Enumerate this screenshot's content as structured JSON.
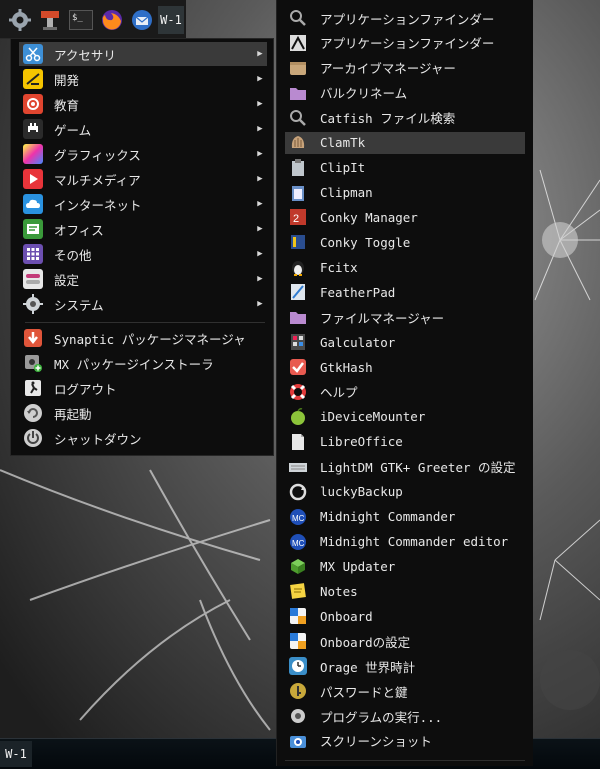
{
  "top_panel": {
    "launchers": [
      {
        "icon": "gear-icon"
      },
      {
        "icon": "package-installer-icon"
      },
      {
        "icon": "terminal-icon",
        "text": "$_"
      },
      {
        "icon": "firefox-icon"
      },
      {
        "icon": "thunderbird-icon"
      }
    ],
    "workspace_label": "W-1"
  },
  "main_menu": {
    "items": [
      {
        "label": "アクセサリ",
        "icon": "scissors-icon",
        "color": "#3d8fd6",
        "submenu": true,
        "highlighted": true
      },
      {
        "label": "開発",
        "icon": "development-icon",
        "color": "#f5c400",
        "submenu": true
      },
      {
        "label": "教育",
        "icon": "education-icon",
        "color": "#e0452f",
        "submenu": true
      },
      {
        "label": "ゲーム",
        "icon": "game-icon",
        "color": "#2b2b2b",
        "submenu": true
      },
      {
        "label": "グラフィックス",
        "icon": "graphics-icon",
        "color": "#b44fd8",
        "submenu": true
      },
      {
        "label": "マルチメディア",
        "icon": "multimedia-icon",
        "color": "#e8343a",
        "submenu": true
      },
      {
        "label": "インターネット",
        "icon": "cloud-icon",
        "color": "#2a92e0",
        "submenu": true
      },
      {
        "label": "オフィス",
        "icon": "office-icon",
        "color": "#3a9a3a",
        "submenu": true
      },
      {
        "label": "その他",
        "icon": "grid-icon",
        "color": "#6c4fb0",
        "submenu": true
      },
      {
        "label": "設定",
        "icon": "settings-icon",
        "color": "#c33a78",
        "submenu": true
      },
      {
        "label": "システム",
        "icon": "system-gear-icon",
        "color": "#6f7a82",
        "submenu": true
      }
    ],
    "actions": [
      {
        "label": "Synaptic パッケージマネージャ",
        "icon": "synaptic-icon",
        "color": "#e0553a"
      },
      {
        "label": "MX パッケージインストーラ",
        "icon": "mx-package-installer-icon",
        "color": "#8a8a8a"
      },
      {
        "label": "ログアウト",
        "icon": "logout-icon",
        "color": "#dddddd"
      },
      {
        "label": "再起動",
        "icon": "restart-icon",
        "color": "#dddddd"
      },
      {
        "label": "シャットダウン",
        "icon": "shutdown-icon",
        "color": "#dddddd"
      }
    ]
  },
  "submenu": {
    "items": [
      {
        "label": "アプリケーションファインダー",
        "icon": "search-icon"
      },
      {
        "label": "アプリケーションファインダー",
        "icon": "app-finder-icon"
      },
      {
        "label": "アーカイブマネージャー",
        "icon": "archive-icon"
      },
      {
        "label": "バルクリネーム",
        "icon": "folder-icon"
      },
      {
        "label": "Catfish ファイル検索",
        "icon": "catfish-search-icon"
      },
      {
        "label": "ClamTk",
        "icon": "clamtk-icon",
        "highlighted": true
      },
      {
        "label": "ClipIt",
        "icon": "clipit-icon"
      },
      {
        "label": "Clipman",
        "icon": "clipman-icon"
      },
      {
        "label": "Conky Manager",
        "icon": "conky-manager-icon"
      },
      {
        "label": "Conky Toggle",
        "icon": "conky-toggle-icon"
      },
      {
        "label": "Fcitx",
        "icon": "penguin-icon"
      },
      {
        "label": "FeatherPad",
        "icon": "featherpad-icon"
      },
      {
        "label": "ファイルマネージャー",
        "icon": "folder-icon"
      },
      {
        "label": "Galculator",
        "icon": "calculator-icon"
      },
      {
        "label": "GtkHash",
        "icon": "gtkhash-icon"
      },
      {
        "label": "ヘルプ",
        "icon": "lifebuoy-icon"
      },
      {
        "label": "iDeviceMounter",
        "icon": "apple-icon"
      },
      {
        "label": "LibreOffice",
        "icon": "libreoffice-icon"
      },
      {
        "label": "LightDM GTK+ Greeter の設定",
        "icon": "keyboard-icon"
      },
      {
        "label": "luckyBackup",
        "icon": "backup-icon"
      },
      {
        "label": "Midnight Commander",
        "icon": "midnight-commander-icon"
      },
      {
        "label": "Midnight Commander editor",
        "icon": "midnight-commander-icon"
      },
      {
        "label": "MX Updater",
        "icon": "mx-updater-icon"
      },
      {
        "label": "Notes",
        "icon": "notes-icon"
      },
      {
        "label": "Onboard",
        "icon": "onboard-icon"
      },
      {
        "label": "Onboardの設定",
        "icon": "onboard-settings-icon"
      },
      {
        "label": "Orage 世界時計",
        "icon": "clock-icon"
      },
      {
        "label": "パスワードと鍵",
        "icon": "key-icon"
      },
      {
        "label": "プログラムの実行...",
        "icon": "run-program-icon"
      },
      {
        "label": "スクリーンショット",
        "icon": "camera-icon"
      }
    ]
  },
  "bottom_panel": {
    "workspace_label": "W-1"
  }
}
